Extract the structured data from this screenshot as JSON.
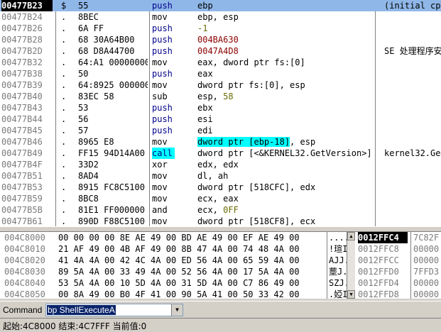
{
  "disasm": {
    "rows": [
      {
        "addr": "00477B23",
        "mark": "$",
        "hex": "55",
        "mn": "push",
        "mnc": "blue",
        "op": [
          {
            "t": "ebp",
            "c": "black"
          }
        ],
        "cm": "(initial cpu selection)"
      },
      {
        "addr": "00477B24",
        "mark": ".",
        "hex": "8BEC",
        "mn": "mov",
        "mnc": "black",
        "op": [
          {
            "t": "ebp, esp",
            "c": "black"
          }
        ],
        "cm": ""
      },
      {
        "addr": "00477B26",
        "mark": ".",
        "hex": "6A FF",
        "mn": "push",
        "mnc": "blue",
        "op": [
          {
            "t": "-1",
            "c": "olive"
          }
        ],
        "cm": ""
      },
      {
        "addr": "00477B28",
        "mark": ".",
        "hex": "68 30A64B00",
        "mn": "push",
        "mnc": "blue",
        "op": [
          {
            "t": "004BA630",
            "c": "red"
          }
        ],
        "cm": ""
      },
      {
        "addr": "00477B2D",
        "mark": ".",
        "hex": "68 D8A44700",
        "mn": "push",
        "mnc": "blue",
        "op": [
          {
            "t": "0047A4D8",
            "c": "red"
          }
        ],
        "cm": "SE 处理程序安装"
      },
      {
        "addr": "00477B32",
        "mark": ".",
        "hex": "64:A1 00000000",
        "mn": "mov",
        "mnc": "black",
        "op": [
          {
            "t": "eax, dword ptr fs:[0]",
            "c": "black"
          }
        ],
        "cm": ""
      },
      {
        "addr": "00477B38",
        "mark": ".",
        "hex": "50",
        "mn": "push",
        "mnc": "blue",
        "op": [
          {
            "t": "eax",
            "c": "black"
          }
        ],
        "cm": ""
      },
      {
        "addr": "00477B39",
        "mark": ".",
        "hex": "64:8925 00000000",
        "mn": "mov",
        "mnc": "black",
        "op": [
          {
            "t": "dword ptr fs:[0], esp",
            "c": "black"
          }
        ],
        "cm": ""
      },
      {
        "addr": "00477B40",
        "mark": ".",
        "hex": "83EC 58",
        "mn": "sub",
        "mnc": "black",
        "op": [
          {
            "t": "esp, ",
            "c": "black"
          },
          {
            "t": "58",
            "c": "olive"
          }
        ],
        "cm": ""
      },
      {
        "addr": "00477B43",
        "mark": ".",
        "hex": "53",
        "mn": "push",
        "mnc": "blue",
        "op": [
          {
            "t": "ebx",
            "c": "black"
          }
        ],
        "cm": ""
      },
      {
        "addr": "00477B44",
        "mark": ".",
        "hex": "56",
        "mn": "push",
        "mnc": "blue",
        "op": [
          {
            "t": "esi",
            "c": "black"
          }
        ],
        "cm": ""
      },
      {
        "addr": "00477B45",
        "mark": ".",
        "hex": "57",
        "mn": "push",
        "mnc": "blue",
        "op": [
          {
            "t": "edi",
            "c": "black"
          }
        ],
        "cm": ""
      },
      {
        "addr": "00477B46",
        "mark": ".",
        "hex": "8965 E8",
        "mn": "mov",
        "mnc": "black",
        "op": [
          {
            "t": "dword ptr [ebp-18]",
            "c": "hl"
          },
          {
            "t": ", esp",
            "c": "black"
          }
        ],
        "cm": ""
      },
      {
        "addr": "00477B49",
        "mark": ".",
        "hex": "FF15 94D14A00",
        "mn": "call",
        "mnc": "callhl",
        "op": [
          {
            "t": "dword ptr [<&KERNEL32.GetVersion>]",
            "c": "black"
          }
        ],
        "cm": "kernel32.GetVersion"
      },
      {
        "addr": "00477B4F",
        "mark": ".",
        "hex": "33D2",
        "mn": "xor",
        "mnc": "black",
        "op": [
          {
            "t": "edx, edx",
            "c": "black"
          }
        ],
        "cm": ""
      },
      {
        "addr": "00477B51",
        "mark": ".",
        "hex": "8AD4",
        "mn": "mov",
        "mnc": "black",
        "op": [
          {
            "t": "dl, ah",
            "c": "black"
          }
        ],
        "cm": ""
      },
      {
        "addr": "00477B53",
        "mark": ".",
        "hex": "8915 FC8C5100",
        "mn": "mov",
        "mnc": "black",
        "op": [
          {
            "t": "dword ptr [518CFC], edx",
            "c": "black"
          }
        ],
        "cm": ""
      },
      {
        "addr": "00477B59",
        "mark": ".",
        "hex": "8BC8",
        "mn": "mov",
        "mnc": "black",
        "op": [
          {
            "t": "ecx, eax",
            "c": "black"
          }
        ],
        "cm": ""
      },
      {
        "addr": "00477B5B",
        "mark": ".",
        "hex": "81E1 FF000000",
        "mn": "and",
        "mnc": "black",
        "op": [
          {
            "t": "ecx, ",
            "c": "black"
          },
          {
            "t": "0FF",
            "c": "olive"
          }
        ],
        "cm": ""
      },
      {
        "addr": "00477B61",
        "mark": ".",
        "hex": "890D F88C5100",
        "mn": "mov",
        "mnc": "black",
        "op": [
          {
            "t": "dword ptr [518CF8], ecx",
            "c": "black"
          }
        ],
        "cm": ""
      }
    ]
  },
  "dump": {
    "rows": [
      {
        "addr": "004C8000",
        "bytes": "00 00 00 00 8E AE 49 00 BD AE 49 00 EF AE 49 00",
        "ascii": "....."
      },
      {
        "addr": "004C8010",
        "bytes": "21 AF 49 00 4B AF 49 00 8B 47 4A 00 74 48 4A 00",
        "ascii": "!瑄I"
      },
      {
        "addr": "004C8020",
        "bytes": "41 4A 4A 00 42 4C 4A 00 ED 56 4A 00 65 59 4A 00",
        "ascii": "AJJ."
      },
      {
        "addr": "004C8030",
        "bytes": "89 5A 4A 00 33 49 4A 00 52 56 4A 00 17 5A 4A 00",
        "ascii": "塟J."
      },
      {
        "addr": "004C8040",
        "bytes": "53 5A 4A 00 10 5D 4A 00 31 5D 4A 00 C7 86 49 00",
        "ascii": "SZJ."
      },
      {
        "addr": "004C8050",
        "bytes": "00 8A 49 00 B0 4F 41 00 90 5A 41 00 50 33 42 00",
        "ascii": ".婭I"
      }
    ],
    "scroll_up": "▲",
    "scroll_down": "▼"
  },
  "stack": {
    "rows": [
      {
        "addr": "0012FFC4",
        "val": "7C82F",
        "sel": true
      },
      {
        "addr": "0012FFC8",
        "val": "00000",
        "sel": false
      },
      {
        "addr": "0012FFCC",
        "val": "00000",
        "sel": false
      },
      {
        "addr": "0012FFD0",
        "val": "7FFD3",
        "sel": false
      },
      {
        "addr": "0012FFD4",
        "val": "00000",
        "sel": false
      },
      {
        "addr": "0012FFD8",
        "val": "00000",
        "sel": false
      }
    ]
  },
  "command": {
    "label": "Command",
    "value": "bp ShellExecuteA",
    "dropdown_icon": "▼"
  },
  "status": {
    "text": "起始:4C8000 结束:4C7FFF 当前值:0"
  },
  "colors": {
    "selection_row": "#8fb7e8",
    "highlight_cyan": "#00ffff",
    "mnemonic_blue": "#00008b",
    "address_gray": "#7b7b7b",
    "constant_red": "#8b0000",
    "constant_olive": "#6b6b00"
  }
}
